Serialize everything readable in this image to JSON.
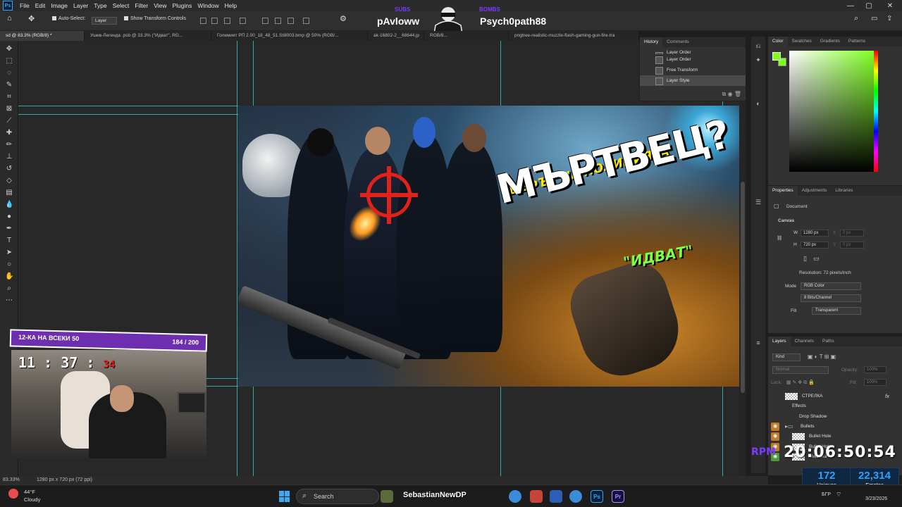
{
  "menu": {
    "logo": "Ps",
    "items": [
      "File",
      "Edit",
      "Image",
      "Layer",
      "Type",
      "Select",
      "Filter",
      "View",
      "Plugins",
      "Window",
      "Help"
    ],
    "window_controls": [
      "—",
      "▢",
      "✕"
    ]
  },
  "options": {
    "auto_select_label": "Auto-Select:",
    "auto_select_value": "Layer",
    "transform_controls_label": "Show Transform Controls"
  },
  "overlay": {
    "left_name": "pAvloww",
    "right_name": "Psych0path88",
    "left_small": "SUBS",
    "right_small": "BOMBS",
    "badge": "1K"
  },
  "tabs": [
    "sd @ 83.3% (RGB/8) *",
    "Ушев-Легенда .psb @ 33.3% (\"Идват\", RG...",
    "Големият PП 2.00_18_48_51.Still003.bmp @ 50% (RGB/...",
    "ak-16802-2__68644.jp",
    "RGB/8...",
    "pngtree-realistic-muzzle-flash-gaming-gun-fire-tra"
  ],
  "artwork": {
    "subtitle": "ШЕФЪТ НА ПОЛИЦИЯТА",
    "title": "МЪРТВЕЦ?",
    "tag": "\"ИДВАТ\""
  },
  "webcam": {
    "goal_label": "12-КА НА ВСЕКИ 50",
    "goal_count": "184 / 200",
    "clock_hm": "11 : 37 :",
    "clock_s": "34"
  },
  "status": {
    "zoom": "83.33%",
    "doc_info": "1280 px x 720 px (72 ppi)"
  },
  "history": {
    "tabs": [
      "History",
      "Comments"
    ],
    "items": [
      "Layer Order",
      "Layer Order",
      "Free Transform",
      "Layer Style"
    ],
    "selected": 3
  },
  "color_panel": {
    "tabs": [
      "Color",
      "Swatches",
      "Gradients",
      "Patterns"
    ],
    "fg_color": "#7dff1e"
  },
  "properties": {
    "tabs": [
      "Properties",
      "Adjustments",
      "Libraries"
    ],
    "kind": "Document",
    "section": "Canvas",
    "w_label": "W",
    "w_value": "1280 px",
    "h_label": "H",
    "h_value": "720 px",
    "x_label": "X",
    "x_value": "0 px",
    "y_label": "Y",
    "y_value": "0 px",
    "resolution": "Resolution: 72 pixels/inch",
    "mode_label": "Mode",
    "mode_value": "RGB Color",
    "depth_value": "8 Bits/Channel",
    "fill_label": "Fill",
    "fill_value": "Transparent"
  },
  "layers": {
    "tabs": [
      "Layers",
      "Channels",
      "Paths"
    ],
    "kind_label": "Kind",
    "blend": "Normal",
    "opacity_label": "Opacity:",
    "opacity_value": "100%",
    "lock_label": "Lock:",
    "fill_label": "Fill:",
    "fill_value": "100%",
    "rows": [
      {
        "name": "СТРЕЛКА",
        "indent": 0,
        "eye": "",
        "thumb": true,
        "fx": "fx"
      },
      {
        "name": "Effects",
        "indent": 1,
        "eye": "",
        "thumb": false,
        "fx": ""
      },
      {
        "name": "Drop Shadow",
        "indent": 2,
        "eye": "",
        "thumb": false,
        "fx": ""
      },
      {
        "name": "Bullets",
        "indent": 0,
        "eye": "orange",
        "thumb": false,
        "fx": ""
      },
      {
        "name": "Bullet Hole",
        "indent": 1,
        "eye": "orange",
        "thumb": true,
        "fx": ""
      },
      {
        "name": "Bullet Hole",
        "indent": 1,
        "eye": "orange",
        "thumb": true,
        "fx": ""
      },
      {
        "name": "Мишена",
        "indent": 1,
        "eye": "green",
        "thumb": true,
        "fx": ""
      }
    ]
  },
  "stream": {
    "rpm": "RPM",
    "clock": "20:06:50:54",
    "uniques_value": "172",
    "uniques_label": "Uniques",
    "emotes_value": "22,314",
    "emotes_label": "Emotes"
  },
  "taskbar": {
    "temp": "44°F",
    "condition": "Cloudy",
    "search": "Search",
    "tiktok": "SebastianNewDP",
    "lang": "БГР",
    "date": "3/23/2026",
    "apps": [
      "Ps",
      "Pr"
    ]
  },
  "colors": {
    "guide": "#3cc7c7",
    "accent_purple": "#6d2fb0",
    "accent_blue": "#29a3ff",
    "photoshop_blue": "#31a8ff"
  }
}
